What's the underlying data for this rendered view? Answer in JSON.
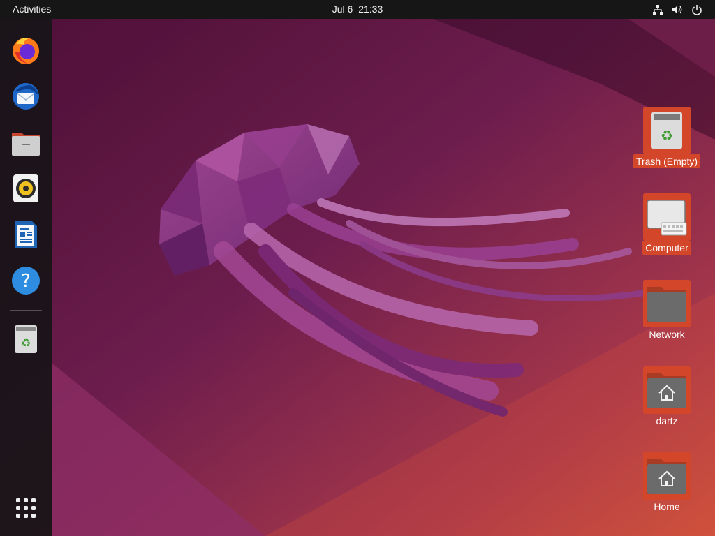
{
  "topbar": {
    "activities_label": "Activities",
    "date": "Jul 6",
    "time": "21:33",
    "tray": [
      "network-icon",
      "volume-icon",
      "power-icon"
    ]
  },
  "dock": {
    "items": [
      "firefox",
      "thunderbird",
      "files",
      "rhythmbox",
      "libreoffice-writer",
      "help",
      "trash"
    ],
    "show_apps_icon": "app-grid-icon"
  },
  "desktop": {
    "icons": [
      {
        "label": "Trash (Empty)",
        "icon": "trash-icon"
      },
      {
        "label": "Computer",
        "icon": "computer-icon"
      },
      {
        "label": "Network",
        "icon": "folder-icon"
      },
      {
        "label": "dartz",
        "icon": "home-folder-icon"
      },
      {
        "label": "Home",
        "icon": "home-folder-icon"
      }
    ]
  },
  "colors": {
    "accent": "#d4462a",
    "wallpaper_dark": "#3d0c2c",
    "wallpaper_mid": "#6b1e50",
    "wallpaper_warm": "#c64f3e",
    "topbar_bg": "#161616"
  }
}
